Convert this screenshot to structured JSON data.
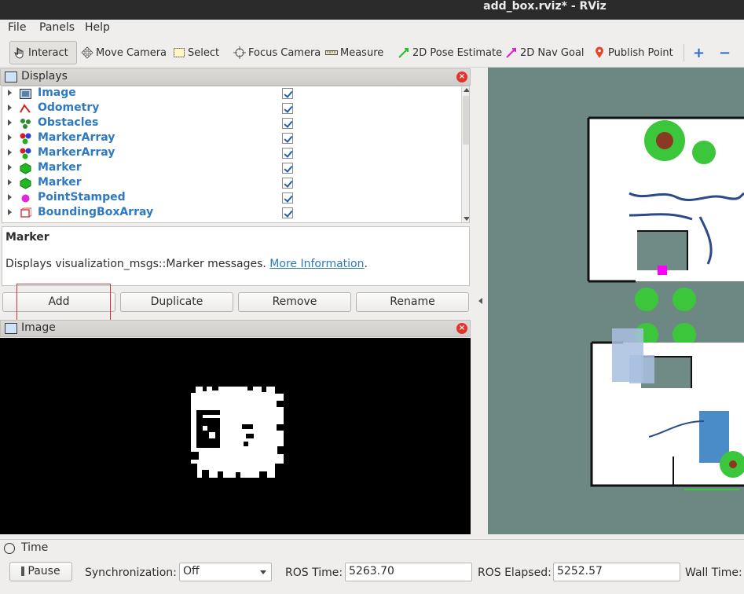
{
  "window": {
    "title": "add_box.rviz* - RViz"
  },
  "menu": [
    "File",
    "Panels",
    "Help"
  ],
  "toolbar": {
    "interact": "Interact",
    "move_camera": "Move Camera",
    "select": "Select",
    "focus_camera": "Focus Camera",
    "measure": "Measure",
    "pose_estimate": "2D Pose Estimate",
    "nav_goal": "2D Nav Goal",
    "publish_point": "Publish Point",
    "plus": "+",
    "minus": "−"
  },
  "displays": {
    "title": "Displays",
    "items": [
      {
        "label": "Image",
        "checked": true,
        "icon": "image-icon"
      },
      {
        "label": "Odometry",
        "checked": true,
        "icon": "odometry-icon"
      },
      {
        "label": "Obstacles",
        "checked": true,
        "icon": "obstacles-icon"
      },
      {
        "label": "MarkerArray",
        "checked": true,
        "icon": "marker-array-icon"
      },
      {
        "label": "MarkerArray",
        "checked": true,
        "icon": "marker-array-icon"
      },
      {
        "label": "Marker",
        "checked": true,
        "icon": "marker-icon"
      },
      {
        "label": "Marker",
        "checked": true,
        "icon": "marker-icon"
      },
      {
        "label": "PointStamped",
        "checked": true,
        "icon": "point-icon"
      },
      {
        "label": "BoundingBoxArray",
        "checked": true,
        "icon": "bounding-box-icon"
      }
    ],
    "desc_title": "Marker",
    "desc_text": "Displays visualization_msgs::Marker messages. ",
    "desc_link": "More Information",
    "desc_end": "."
  },
  "buttons": {
    "add": "Add",
    "duplicate": "Duplicate",
    "remove": "Remove",
    "rename": "Rename"
  },
  "image_panel": {
    "title": "Image"
  },
  "time": {
    "title": "Time",
    "pause": "Pause",
    "sync_label": "Synchronization:",
    "sync_value": "Off",
    "ros_time_label": "ROS Time:",
    "ros_time": "5263.70",
    "ros_elapsed_label": "ROS Elapsed:",
    "ros_elapsed": "5252.57",
    "wall_time_label": "Wall Time:"
  },
  "colors": {
    "link": "#2e79c2",
    "close": "#e0342b",
    "highlight": "#e03131",
    "viewport": "#6d8883"
  }
}
